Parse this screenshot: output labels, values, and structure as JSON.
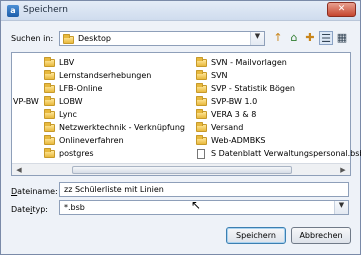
{
  "window": {
    "title": "Speichern",
    "app_icon_letter": "a",
    "close_glyph": "✕"
  },
  "look_in": {
    "label": "Suchen in:",
    "value": "Desktop"
  },
  "toolbar": {
    "back_glyph": "↑",
    "home_glyph": "⌂",
    "newfolder_glyph": "✚",
    "list_glyph": "☰",
    "details_glyph": "▦"
  },
  "files": {
    "column1": [
      {
        "name": "LBV",
        "type": "folder"
      },
      {
        "name": "Lernstandserhebungen",
        "type": "folder"
      },
      {
        "name": "LFB-Online",
        "type": "folder"
      },
      {
        "name": "LOBW",
        "type": "folder"
      },
      {
        "name": "Lync",
        "type": "folder"
      },
      {
        "name": "Netzwerktechnik - Verknüpfung",
        "type": "folder"
      },
      {
        "name": "Onlineverfahren",
        "type": "folder"
      },
      {
        "name": "postgres",
        "type": "folder"
      }
    ],
    "column2": [
      {
        "name": "SVN - Mailvorlagen",
        "type": "folder"
      },
      {
        "name": "SVN",
        "type": "folder"
      },
      {
        "name": "SVP - Statistik Bögen",
        "type": "folder"
      },
      {
        "name": "SVP-BW 1.0",
        "type": "folder"
      },
      {
        "name": "VERA 3 & 8",
        "type": "folder"
      },
      {
        "name": "Versand",
        "type": "folder"
      },
      {
        "name": "Web-ADMBKS",
        "type": "folder"
      },
      {
        "name": "S Datenblatt Verwaltungspersonal.bsb",
        "type": "file"
      }
    ],
    "clipped_left_text": "VP-BW"
  },
  "filename": {
    "label_underlined": "D",
    "label_rest": "ateiname:",
    "value": "zz Schülerliste mit Linien"
  },
  "filetype": {
    "label_start": "Date",
    "label_underlined": "i",
    "label_rest": "typ:",
    "value": "*.bsb"
  },
  "buttons": {
    "save": "Speichern",
    "cancel": "Abbrechen"
  },
  "scrollbar": {
    "left_glyph": "◀",
    "right_glyph": "▶"
  },
  "combo_arrow_glyph": "▼"
}
